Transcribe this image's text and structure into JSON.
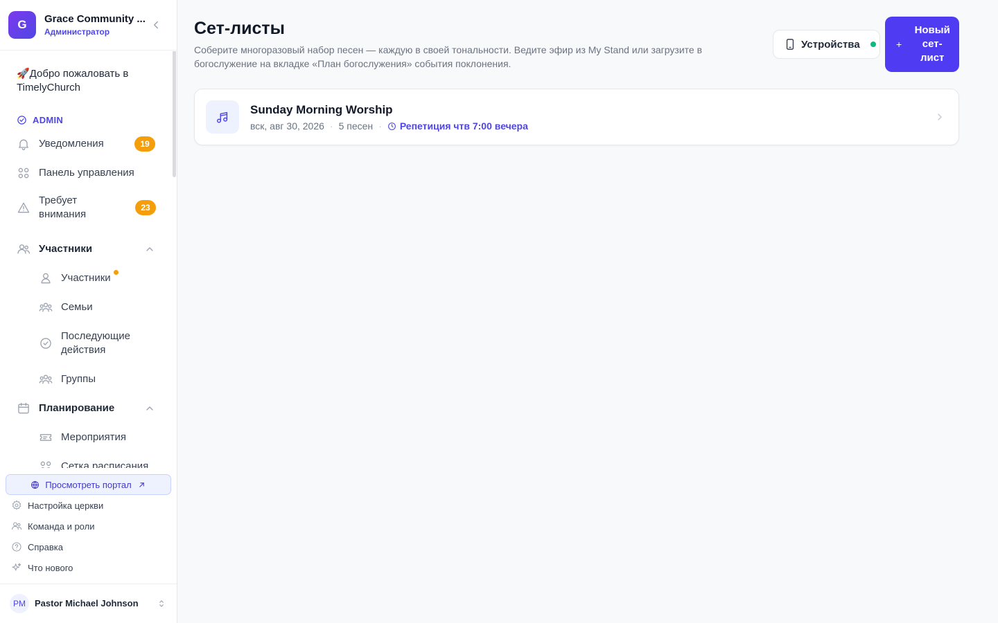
{
  "app": {
    "org_name": "Grace Community ...",
    "org_initial": "G",
    "org_role": "Администратор"
  },
  "sidebar": {
    "welcome": "🚀Добро пожаловать в TimelyChurch",
    "admin_section": "ADMIN",
    "items": {
      "notifications": {
        "label": "Уведомления",
        "badge": "19"
      },
      "dashboard": {
        "label": "Панель управления"
      },
      "attention": {
        "label": "Требует внимания",
        "badge": "23"
      },
      "members_group": {
        "label": "Участники"
      },
      "members": {
        "label": "Участники"
      },
      "families": {
        "label": "Семьи"
      },
      "followups": {
        "label": "Последующие действия"
      },
      "groups": {
        "label": "Группы"
      },
      "planning_group": {
        "label": "Планирование"
      },
      "events": {
        "label": "Мероприятия"
      },
      "schedule": {
        "label": "Сетка расписания"
      }
    },
    "portal_button": "Просмотреть портал",
    "bottom_links": {
      "church_settings": "Настройка церкви",
      "team_roles": "Команда и роли",
      "help": "Справка",
      "whats_new": "Что нового"
    },
    "user": {
      "initials": "PM",
      "name": "Pastor Michael Johnson"
    }
  },
  "main": {
    "title": "Сет-листы",
    "subtitle": "Соберите многоразовый набор песен — каждую в своей тональности. Ведите эфир из My Stand или загрузите в богослужение на вкладке «План богослужения» события поклонения.",
    "devices_button": "Устройства",
    "new_button_plus": "+",
    "new_button": "Новый сет-лист",
    "setlists": [
      {
        "title": "Sunday Morning Worship",
        "date": "вск, авг 30, 2026",
        "songs": "5 песен",
        "rehearsal": "Репетиция чтв 7:00 вечера"
      }
    ]
  },
  "colors": {
    "accent": "#4f46e5",
    "primary_button": "#4f3cf2",
    "badge": "#f59e0b",
    "status_online": "#10b981"
  }
}
